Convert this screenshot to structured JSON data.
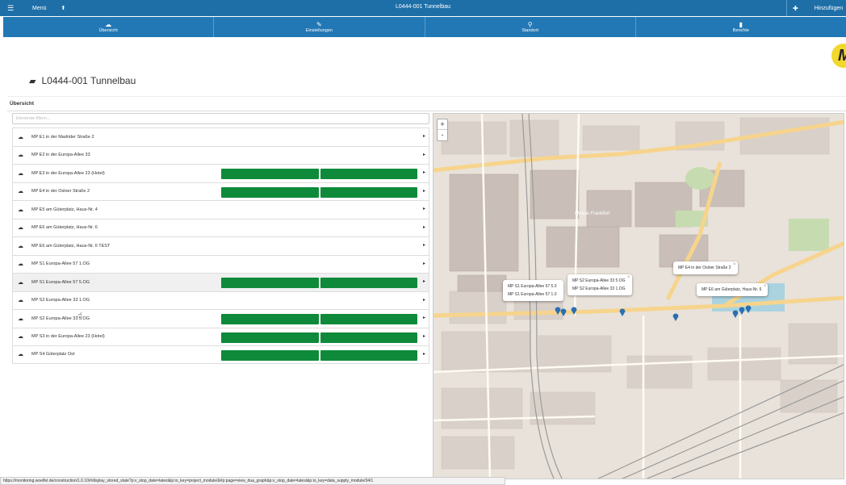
{
  "topbar": {
    "menu_label": "Menü",
    "title": "L0444-001 Tunnelbau",
    "add_label": "Hinzufügen"
  },
  "tabs": [
    {
      "label": "Übersicht",
      "icon": "dashboard-icon"
    },
    {
      "label": "Einstellungen",
      "icon": "wrench-icon"
    },
    {
      "label": "Standort",
      "icon": "map-marker-icon"
    },
    {
      "label": "Berichte",
      "icon": "document-icon"
    }
  ],
  "logo": {
    "text": "M"
  },
  "page": {
    "title": "L0444-001 Tunnelbau"
  },
  "section": {
    "title": "Übersicht"
  },
  "filter": {
    "placeholder": "Elemente filtern..."
  },
  "colors": {
    "accent": "#1e6fa8",
    "bar": "#0e8a3a"
  },
  "items": [
    {
      "label": "MP E1 in der Madrider Straße 2",
      "bars": false
    },
    {
      "label": "MP E2 in der Europa-Allee 33",
      "bars": false
    },
    {
      "label": "MP E3 in der Europa-Allee 23 (Hotel)",
      "bars": true
    },
    {
      "label": "MP E4 in der Osloer Straße 2",
      "bars": true
    },
    {
      "label": "MP E5 am Güterplatz, Haus-Nr. 4",
      "bars": false
    },
    {
      "label": "MP E6 am Güterplatz, Haus-Nr. 6",
      "bars": false
    },
    {
      "label": "MP E6 am Güterplatz, Haus-Nr. 6 TEST",
      "bars": false
    },
    {
      "label": "MP S1 Europa-Allee 57 1.OG",
      "bars": false
    },
    {
      "label": "MP S1 Europa-Allee 57 5.OG",
      "bars": true
    },
    {
      "label": "MP S2 Europa-Allee 33 1.OG",
      "bars": false
    },
    {
      "label": "MP S2 Europa-Allee 33 5.OG",
      "bars": true
    },
    {
      "label": "MP S3 in der Europa-Allee 23 (Hotel)",
      "bars": true
    },
    {
      "label": "MP S4 Güterplatz Ost",
      "bars": true
    }
  ],
  "map": {
    "zoom_in": "+",
    "zoom_out": "-",
    "label_messe": "Messe Frankfurt",
    "popups": [
      {
        "lines": [
          "MP S1 Europa-Allee 57 5.0",
          "MP S1 Europa-Allee 57 1.0"
        ]
      },
      {
        "lines": [
          "MP S2 Europa-Allee 33 5.OG",
          "MP S2 Europa-Allee 33 1.OG"
        ]
      },
      {
        "lines": [
          "MP E4 in der Osloer Straße 2"
        ]
      },
      {
        "lines": [
          "MP E6 am Güterplatz, Haus-Nr. 6"
        ]
      }
    ]
  },
  "status_url": "https://monitoring.woelfel.de/construction/1.0.10/#display_stored_state?p:v_stop_date=latest&p:io_key=project_module/&#p:page=view_dua_graph&p:v_stop_date=latest&p:io_key=data_supply_module/34/1"
}
